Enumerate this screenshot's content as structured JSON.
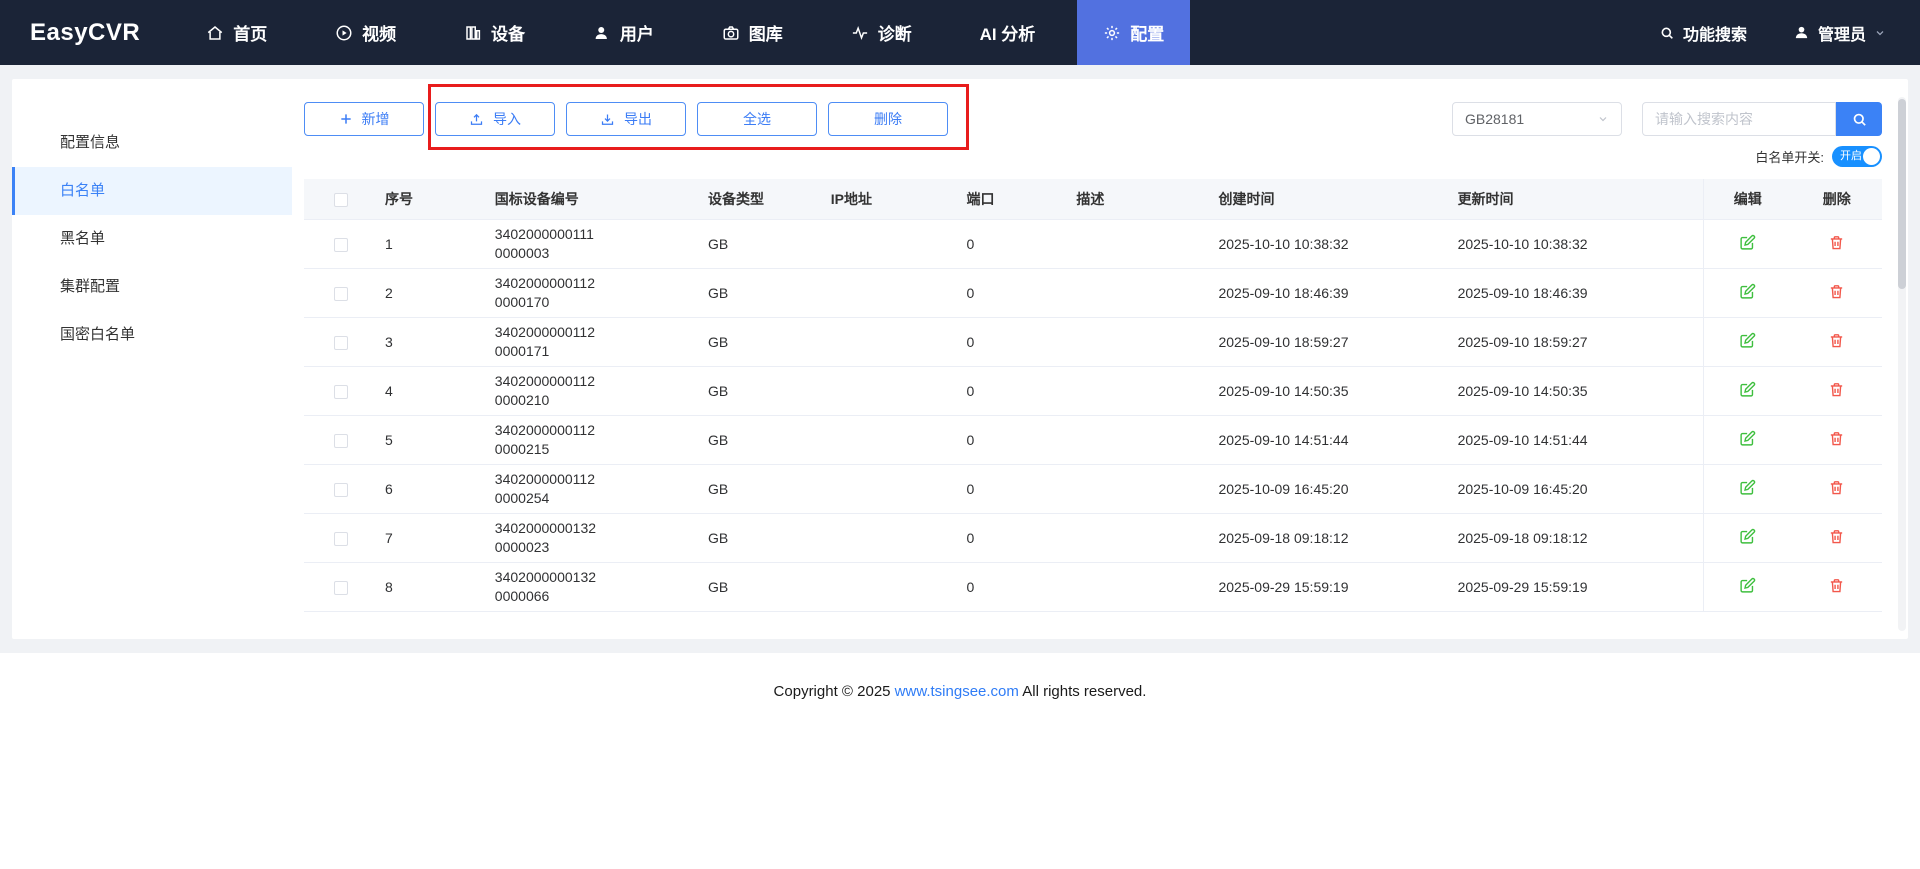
{
  "navbar": {
    "logo": "EasyCVR",
    "items": [
      {
        "label": "首页",
        "icon": "home-icon",
        "active": false
      },
      {
        "label": "视频",
        "icon": "video-icon",
        "active": false
      },
      {
        "label": "设备",
        "icon": "device-icon",
        "active": false
      },
      {
        "label": "用户",
        "icon": "user-icon",
        "active": false
      },
      {
        "label": "图库",
        "icon": "gallery-icon",
        "active": false
      },
      {
        "label": "诊断",
        "icon": "diagnosis-icon",
        "active": false
      },
      {
        "label": "AI 分析",
        "icon": "",
        "active": false
      },
      {
        "label": "配置",
        "icon": "gear-icon",
        "active": true
      }
    ],
    "search_label": "功能搜索",
    "user_label": "管理员"
  },
  "sidebar": {
    "items": [
      {
        "label": "配置信息",
        "active": false
      },
      {
        "label": "白名单",
        "active": true
      },
      {
        "label": "黑名单",
        "active": false
      },
      {
        "label": "集群配置",
        "active": false
      },
      {
        "label": "国密白名单",
        "active": false
      }
    ]
  },
  "toolbar": {
    "add_label": "新增",
    "import_label": "导入",
    "export_label": "导出",
    "select_all_label": "全选",
    "delete_label": "删除",
    "protocol_selected": "GB28181",
    "search_placeholder": "请输入搜索内容",
    "switch_label": "白名单开关:",
    "switch_state": "开启"
  },
  "table": {
    "headers": [
      "序号",
      "国标设备编号",
      "设备类型",
      "IP地址",
      "端口",
      "描述",
      "创建时间",
      "更新时间",
      "编辑",
      "删除"
    ],
    "rows": [
      {
        "index": "1",
        "device_id_line1": "3402000000111",
        "device_id_line2": "0000003",
        "type": "GB",
        "ip": "",
        "port": "0",
        "desc": "",
        "created": "2025-10-10 10:38:32",
        "updated": "2025-10-10 10:38:32"
      },
      {
        "index": "2",
        "device_id_line1": "3402000000112",
        "device_id_line2": "0000170",
        "type": "GB",
        "ip": "",
        "port": "0",
        "desc": "",
        "created": "2025-09-10 18:46:39",
        "updated": "2025-09-10 18:46:39"
      },
      {
        "index": "3",
        "device_id_line1": "3402000000112",
        "device_id_line2": "0000171",
        "type": "GB",
        "ip": "",
        "port": "0",
        "desc": "",
        "created": "2025-09-10 18:59:27",
        "updated": "2025-09-10 18:59:27"
      },
      {
        "index": "4",
        "device_id_line1": "3402000000112",
        "device_id_line2": "0000210",
        "type": "GB",
        "ip": "",
        "port": "0",
        "desc": "",
        "created": "2025-09-10 14:50:35",
        "updated": "2025-09-10 14:50:35"
      },
      {
        "index": "5",
        "device_id_line1": "3402000000112",
        "device_id_line2": "0000215",
        "type": "GB",
        "ip": "",
        "port": "0",
        "desc": "",
        "created": "2025-09-10 14:51:44",
        "updated": "2025-09-10 14:51:44"
      },
      {
        "index": "6",
        "device_id_line1": "3402000000112",
        "device_id_line2": "0000254",
        "type": "GB",
        "ip": "",
        "port": "0",
        "desc": "",
        "created": "2025-10-09 16:45:20",
        "updated": "2025-10-09 16:45:20"
      },
      {
        "index": "7",
        "device_id_line1": "3402000000132",
        "device_id_line2": "0000023",
        "type": "GB",
        "ip": "",
        "port": "0",
        "desc": "",
        "created": "2025-09-18 09:18:12",
        "updated": "2025-09-18 09:18:12"
      },
      {
        "index": "8",
        "device_id_line1": "3402000000132",
        "device_id_line2": "0000066",
        "type": "GB",
        "ip": "",
        "port": "0",
        "desc": "",
        "created": "2025-09-29 15:59:19",
        "updated": "2025-09-29 15:59:19"
      }
    ]
  },
  "footer": {
    "text_before": "Copyright © 2025 ",
    "link_text": "www.tsingsee.com",
    "text_after": " All rights reserved."
  }
}
